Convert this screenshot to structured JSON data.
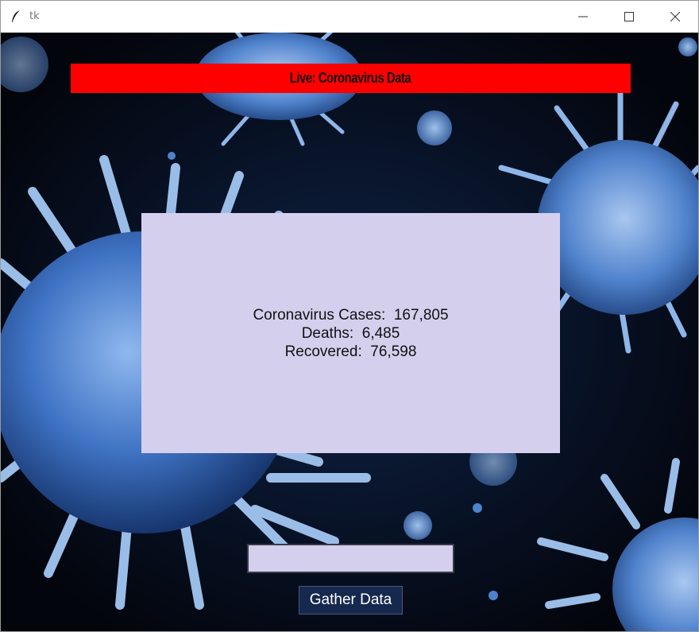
{
  "window": {
    "title": "tk"
  },
  "banner": {
    "text": "Live: Coronavirus Data",
    "color": "#ff0000"
  },
  "stats": {
    "cases_label": "Coronavirus Cases:",
    "cases_value": "167,805",
    "deaths_label": "Deaths:",
    "deaths_value": "6,485",
    "recovered_label": "Recovered:",
    "recovered_value": "76,598"
  },
  "entry": {
    "value": ""
  },
  "button": {
    "label": "Gather Data"
  },
  "background": {
    "description_icon": "coronavirus-image",
    "base_color": "#05070f",
    "virus_color": "#5a8fd6"
  }
}
